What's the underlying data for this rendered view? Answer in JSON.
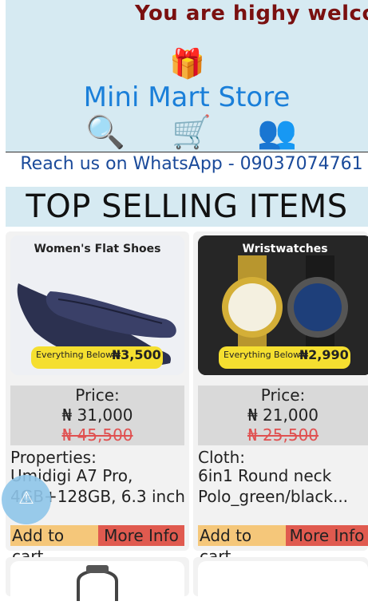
{
  "marquee": {
    "text": "You are highy welcom"
  },
  "header": {
    "gift_icon": "gift-icon",
    "title": "Mini Mart Store",
    "nav_icons": [
      "search-icon",
      "cart-icon",
      "users-icon"
    ]
  },
  "contact": {
    "text": "Reach us on WhatsApp - 09037074761"
  },
  "section": {
    "title": "TOP SELLING ITEMS"
  },
  "products": [
    {
      "banner_title": "Women's Flat Shoes",
      "badge_prefix": "Everything Below",
      "badge_price": "₦3,500",
      "price_label": "Price:",
      "price": "₦ 31,000",
      "old_price": "₦ 45,500",
      "props_label": "Properties:",
      "props_line1": "Umidigi A7 Pro,",
      "props_line2": "4GB+128GB, 6.3 inch",
      "cart_label": "Add to cart",
      "info_label": "More Info"
    },
    {
      "banner_title": "Wristwatches",
      "badge_prefix": "Everything Below",
      "badge_price": "₦2,990",
      "price_label": "Price:",
      "price": "₦ 21,000",
      "old_price": "₦ 25,500",
      "props_label": "Cloth:",
      "props_line1": "6in1 Round neck",
      "props_line2": "Polo_green/black...",
      "cart_label": "Add to cart",
      "info_label": "More Info"
    }
  ],
  "colors": {
    "accent": "#1a7fd9",
    "header_bg": "#d6eaf2",
    "cart_btn": "#f5c77a",
    "info_btn": "#e05a4f",
    "old_price": "#e05050"
  },
  "fab": {
    "icon": "warning-icon"
  }
}
